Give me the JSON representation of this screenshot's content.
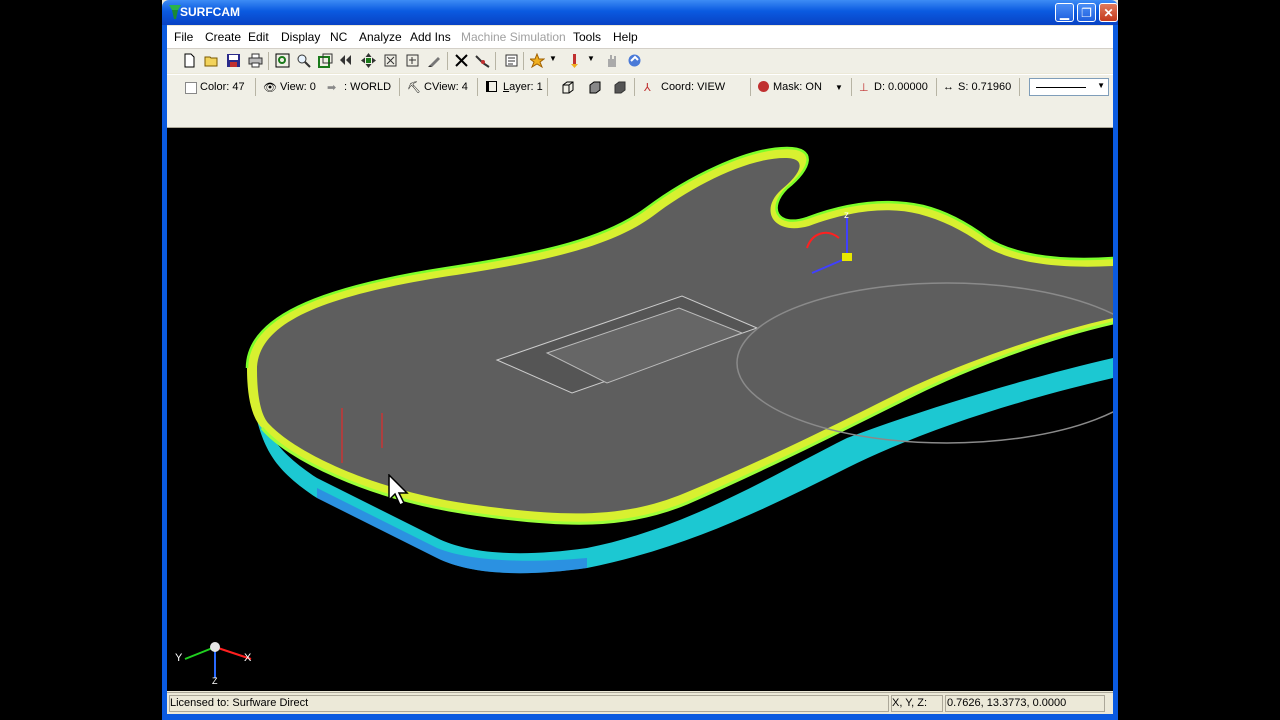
{
  "window": {
    "title": "SURFCAM"
  },
  "menu": [
    {
      "label": "File",
      "disabled": false
    },
    {
      "label": "Create",
      "disabled": false
    },
    {
      "label": "Edit",
      "disabled": false
    },
    {
      "label": "Display",
      "disabled": false
    },
    {
      "label": "NC",
      "disabled": false
    },
    {
      "label": "Analyze",
      "disabled": false
    },
    {
      "label": "Add Ins",
      "disabled": false
    },
    {
      "label": "Machine Simulation",
      "disabled": true
    },
    {
      "label": "Tools",
      "disabled": false
    },
    {
      "label": "Help",
      "disabled": false
    }
  ],
  "props": {
    "color": "Color: 47",
    "view": "View: 0",
    "world": ": WORLD",
    "cview": "CView: 4",
    "layer_prefix": "L",
    "layer_rest": "ayer: 1",
    "coord": "Coord: VIEW",
    "mask": "Mask: ON",
    "depth": "D: 0.00000",
    "step": "S: 0.71960"
  },
  "status": {
    "license": "Licensed to: Surfware Direct",
    "xyz_label": "X, Y, Z:",
    "xyz_value": "0.7626, 13.3773, 0.0000"
  },
  "triad": {
    "y": "Y",
    "x": "X",
    "z": "Z"
  },
  "colors": {
    "titlebar": "#0a5ae0",
    "surface": "#5e5e5e",
    "toolpath_green": "#7cff2a",
    "toolpath_yellow": "#e6ff3a",
    "side_cyan": "#28e0e6"
  }
}
